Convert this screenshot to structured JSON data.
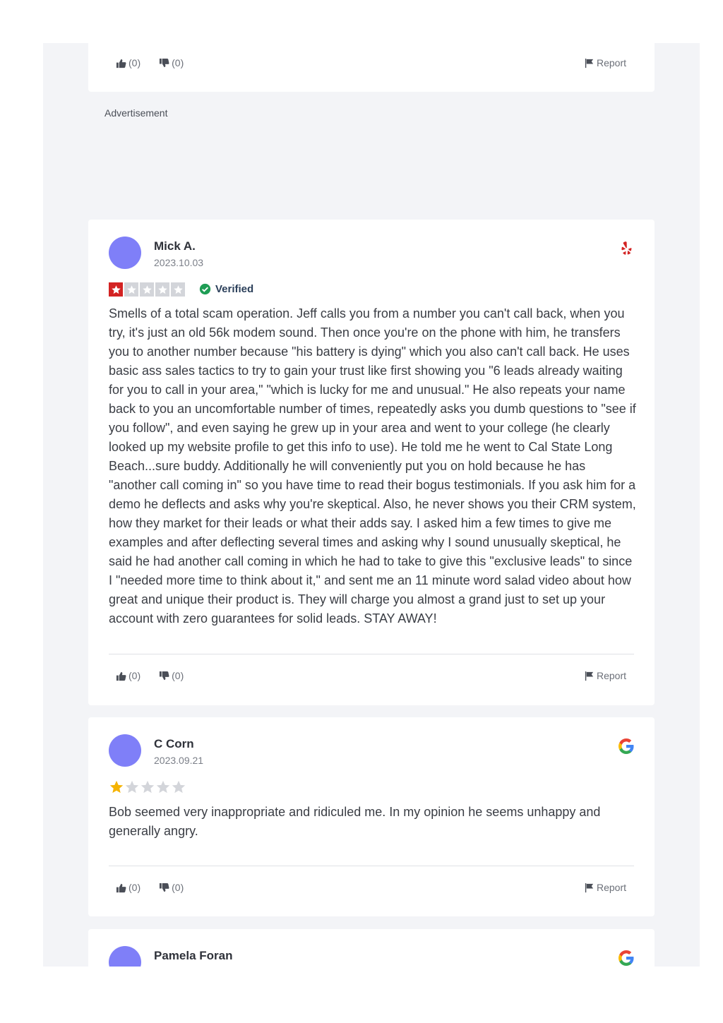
{
  "top_card": {
    "likes": "(0)",
    "dislikes": "(0)",
    "report_label": "Report"
  },
  "advertisement_label": "Advertisement",
  "reviews": [
    {
      "name": "Mick A.",
      "date": "2023.10.03",
      "source_icon": "yelp-icon",
      "rating": 1,
      "max_rating": 5,
      "verified_label": "Verified",
      "text": "Smells of a total scam operation. Jeff calls you from a number you can't call back, when you try, it's just an old 56k modem sound. Then once you're on the phone with him, he transfers you to another number because \"his battery is dying\" which you also can't call back. He uses basic ass sales tactics to try to gain your trust like first showing you \"6 leads already waiting for you to call in your area,\" \"which is lucky for me and unusual.\" He also repeats your name back to you an uncomfortable number of times, repeatedly asks you dumb questions to \"see if you follow\", and even saying he grew up in your area and went to your college (he clearly looked up my website profile to get this info to use). He told me he went to Cal State Long Beach...sure buddy. Additionally he will conveniently put you on hold because he has \"another call coming in\" so you have time to read their bogus testimonials. If you ask him for a demo he deflects and asks why you're skeptical. Also, he never shows you their CRM system, how they market for their leads or what their adds say. I asked him a few times to give me examples and after deflecting several times and asking why I sound unusually skeptical, he said he had another call coming in which he had to take to give this \"exclusive leads\" to since I \"needed more time to think about it,\" and sent me an 11 minute word salad video about how great and unique their product is. They will charge you almost a grand just to set up your account with zero guarantees for solid leads. STAY AWAY!",
      "likes": "(0)",
      "dislikes": "(0)",
      "report_label": "Report"
    },
    {
      "name": "C Corn",
      "date": "2023.09.21",
      "source_icon": "google-icon",
      "rating": 1,
      "max_rating": 5,
      "text": "Bob seemed very inappropriate and ridiculed me. In my opinion he seems unhappy and generally angry.",
      "likes": "(0)",
      "dislikes": "(0)",
      "report_label": "Report"
    },
    {
      "name": "Pamela Foran",
      "source_icon": "google-icon"
    }
  ],
  "colors": {
    "panel_bg": "#f3f4f7",
    "avatar": "#7f7ff8",
    "yelp_red": "#d32323",
    "star_gold": "#f5b301",
    "verified_green": "#1f9d55"
  }
}
